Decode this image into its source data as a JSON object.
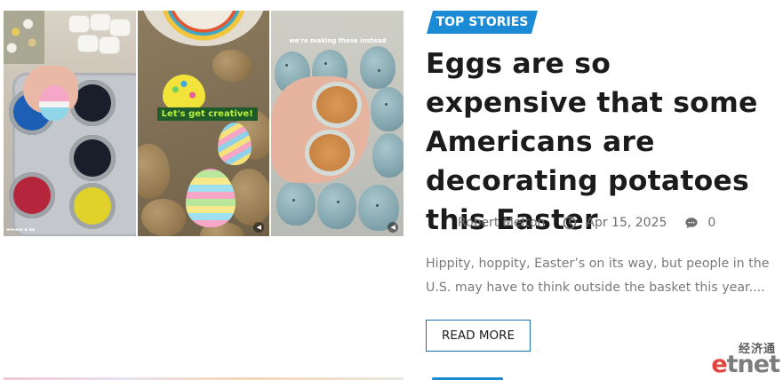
{
  "article": {
    "category": "TOP STORIES",
    "title": "Eggs are so expensive that some Americans are decorating potatoes this Easter",
    "author": "Robert Melton",
    "date": "Apr 15, 2025",
    "comments": "0",
    "excerpt": "Hippity, hoppity, Easter’s on its way, but people in the U.S. may have to think outside the basket this year....",
    "read_more_label": "READ MORE"
  },
  "image": {
    "panel_2_caption": "Let's get creative!",
    "panel_3_caption": "we're making these instead"
  },
  "icons": {
    "author": "author-avatar-icon",
    "date": "clock-icon",
    "comments": "comment-bubble-icon",
    "mute": "speaker-icon"
  },
  "watermark": {
    "chinese": "经济通",
    "logo_e": "e",
    "logo_rest": "tnet"
  },
  "colors": {
    "accent": "#1a8bd4",
    "title": "#1b1b1b",
    "meta": "#6e6e6e",
    "excerpt": "#7a7a7a",
    "watermark_red": "#e2453f"
  }
}
